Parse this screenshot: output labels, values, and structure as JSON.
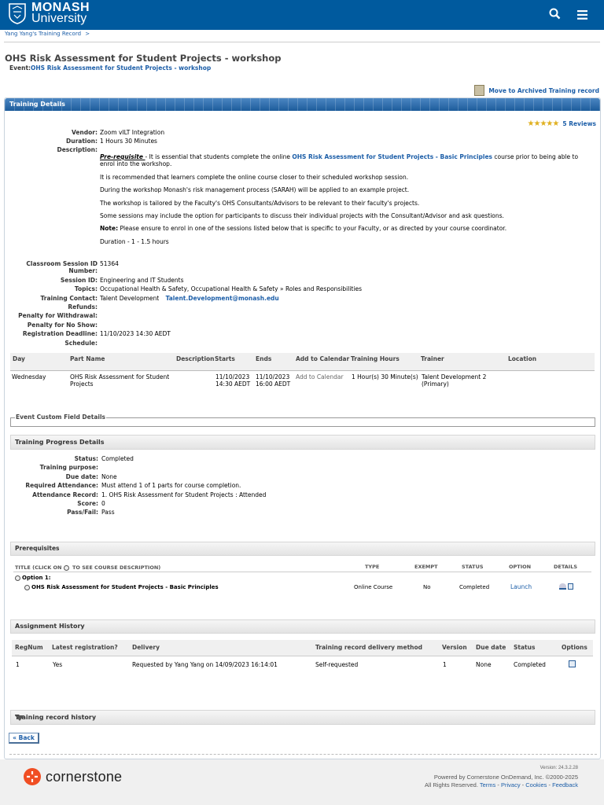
{
  "header": {
    "brand_line1": "MONASH",
    "brand_line2": "University",
    "search_icon": "search-icon",
    "menu_icon": "hamburger-menu-icon"
  },
  "breadcrumb": {
    "item": "Yang Yang's Training Record",
    "separator": ">"
  },
  "page_title": "OHS Risk Assessment for Student Projects - workshop",
  "event": {
    "label": "Event:",
    "value": "OHS Risk Assessment for Student Projects - workshop"
  },
  "archive_link": "Move to Archived Training record",
  "panel_title": "Training Details",
  "reviews": {
    "stars": "★★★★★",
    "label": "5 Reviews"
  },
  "details": {
    "vendor_label": "Vendor:",
    "vendor": "Zoom vILT Integration",
    "duration_label": "Duration:",
    "duration": "1 Hours 30 Minutes",
    "description_label": "Description:",
    "prereq_label": "Pre-requisite ",
    "prereq_dash": "- It is essential that students complete the online",
    "prereq_link": "OHS Risk Assessment for Student Projects - Basic Principles",
    "prereq_tail": "course prior to being able to enrol into the workshop.",
    "p2": "It is recommended that learners complete the online course closer to their scheduled workshop session.",
    "p3": "During the workshop Monash's risk management process (SARAH) will be applied to an example project.",
    "p4": "The workshop is tailored by the Faculty's OHS Consultants/Advisors to be relevant to their faculty's projects.",
    "p5": "Some sessions may include the option for participants to discuss their individual projects with the Consultant/Advisor and ask questions.",
    "note_label": "Note:",
    "note": "Please ensure to enrol in one of the sessions listed below that is specific to your Faculty, or as directed by your course coordinator.",
    "p7": "Duration - 1 - 1.5 hours",
    "session_id_num_label1": "Classroom Session ID",
    "session_id_num_label2": "Number:",
    "session_id_num": "51364",
    "session_id_label": "Session ID:",
    "session_id": "Engineering and IT Students",
    "topics_label": "Topics:",
    "topics": "Occupational Health & Safety, Occupational Health & Safety » Roles and Responsibilities",
    "contact_label": "Training Contact:",
    "contact_name": "Talent Development",
    "contact_email": "Talent.Development@monash.edu",
    "refunds_label": "Refunds:",
    "withdrawal_label": "Penalty for Withdrawal:",
    "noshow_label": "Penalty for No Show:",
    "deadline_label": "Registration Deadline:",
    "deadline": "11/10/2023 14:30 AEDT",
    "schedule_label": "Schedule:"
  },
  "schedule": {
    "headers": [
      "Day",
      "Part Name",
      "Description",
      "Starts",
      "Ends",
      "Add to Calendar",
      "Training Hours",
      "Trainer",
      "Location"
    ],
    "row": {
      "day": "Wednesday",
      "part_name": "OHS Risk Assessment for Student Projects",
      "starts": "11/10/2023 14:30 AEDT",
      "ends": "11/10/2023 16:00 AEDT",
      "calendar": "Add to Calendar",
      "hours": "1 Hour(s) 30 Minute(s)",
      "trainer": "Talent Development 2 (Primary)"
    }
  },
  "custom_fields_legend": "Event Custom Field Details",
  "progress": {
    "title": "Training Progress Details",
    "status_label": "Status:",
    "status": "Completed",
    "purpose_label": "Training purpose:",
    "due_label": "Due date:",
    "due": "None",
    "req_label": "Required Attendance:",
    "req": "Must attend 1 of 1 parts for course completion.",
    "att_label": "Attendance Record:",
    "att": "1. OHS Risk Assessment for Student Projects : Attended",
    "score_label": "Score:",
    "score": "0",
    "pass_label": "Pass/Fail:",
    "pass": "Pass"
  },
  "prereq": {
    "title": "Prerequisites",
    "col_title_a": "Title (click on",
    "col_title_b": "to see course description)",
    "col_type": "Type",
    "col_exempt": "Exempt",
    "col_status": "Status",
    "col_option": "Option",
    "col_details": "Details",
    "option_label": "Option 1:",
    "course": "OHS Risk Assessment for Student Projects - Basic Principles",
    "type": "Online Course",
    "exempt": "No",
    "status": "Completed",
    "launch": "Launch"
  },
  "assignment": {
    "title": "Assignment History",
    "headers": [
      "RegNum",
      "Latest registration?",
      "Delivery",
      "Training record delivery method",
      "Version",
      "Due date",
      "Status",
      "Options"
    ],
    "row": [
      "1",
      "Yes",
      "Requested by Yang Yang on 14/09/2023 16:14:01",
      "Self-requested",
      "1",
      "None",
      "Completed"
    ]
  },
  "record_history": "Training record history",
  "back": "« Back",
  "footer": {
    "brand": "cornerstone",
    "version": "Version: 24.3.2.28",
    "powered": "Powered by Cornerstone OnDemand, Inc. ©2000-2025",
    "rights": "All Rights Reserved.",
    "links": [
      "Terms",
      "Privacy",
      "Cookies",
      "Feedback"
    ],
    "sep": "-"
  },
  "colors": {
    "brand": "#005a9e",
    "link": "#1c5ea8",
    "cornerstone": "#f04e23"
  }
}
